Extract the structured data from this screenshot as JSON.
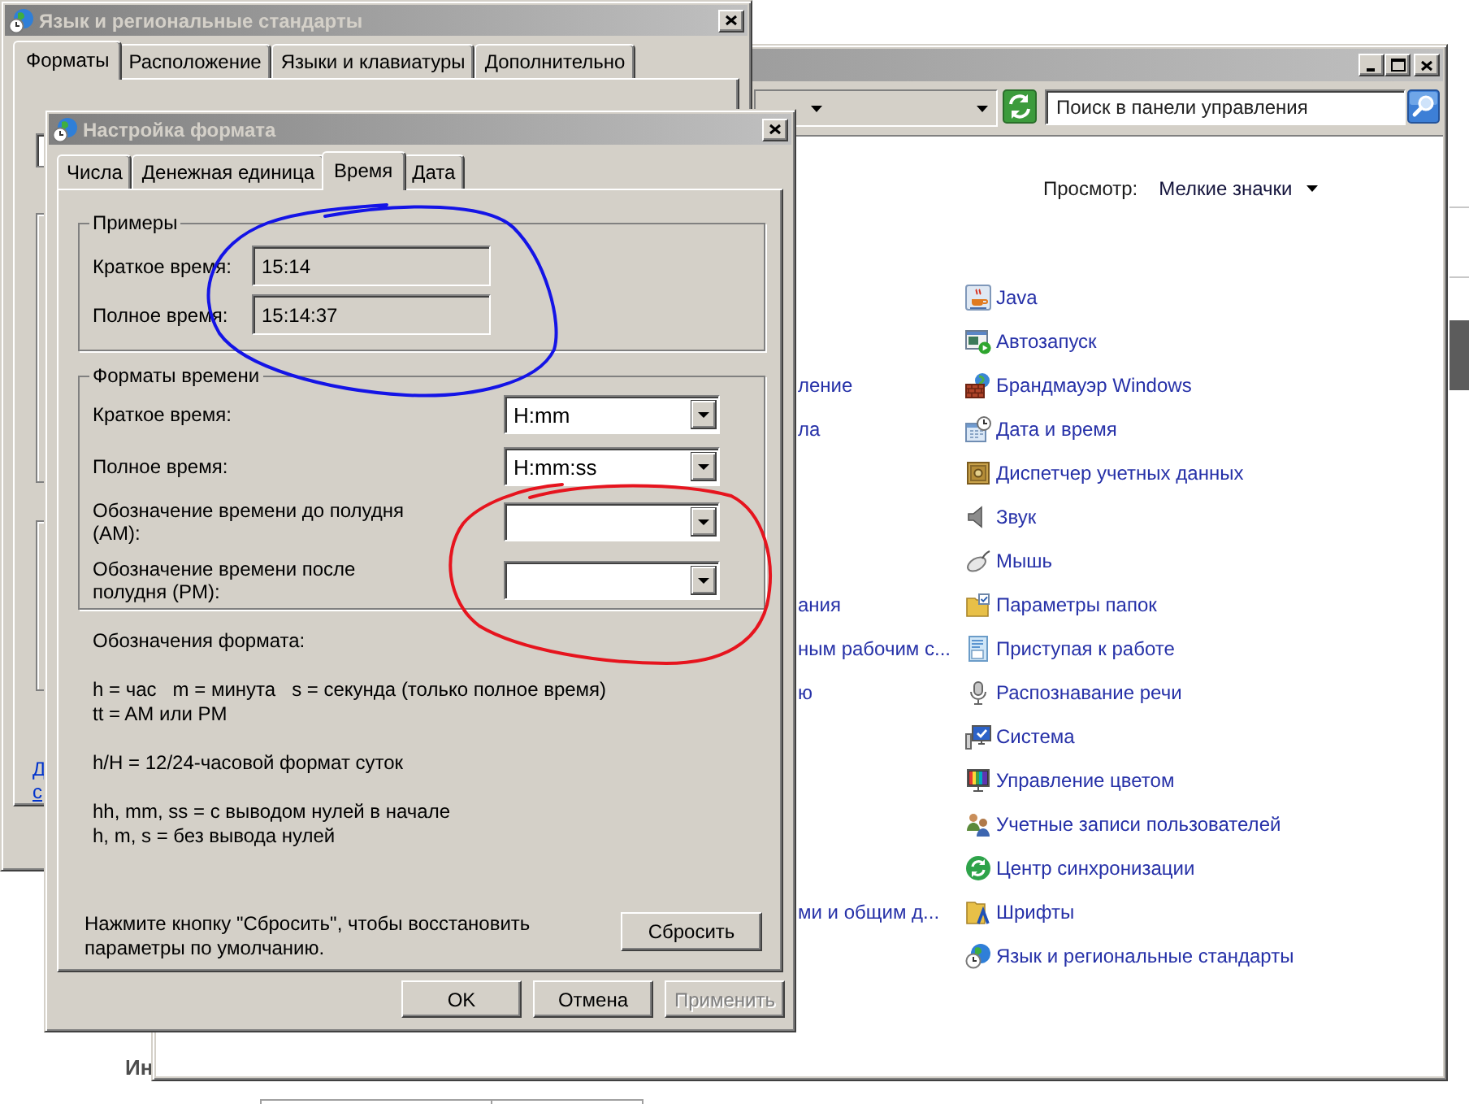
{
  "desktop": {
    "partial_heading": "Ин"
  },
  "control_panel": {
    "active": false,
    "search": {
      "placeholder": "Поиск в панели управления"
    },
    "view_label": "Просмотр:",
    "view_mode": "Мелкие значки",
    "left_column": [
      "ление",
      "ла",
      "ания",
      "ным рабочим с...",
      "ю",
      "ми и общим д..."
    ],
    "items": [
      {
        "kind": "java",
        "label": "Java"
      },
      {
        "kind": "autoplay",
        "label": "Автозапуск"
      },
      {
        "kind": "firewall",
        "label": "Брандмауэр Windows"
      },
      {
        "kind": "datetime",
        "label": "Дата и время"
      },
      {
        "kind": "credentials",
        "label": "Диспетчер учетных данных"
      },
      {
        "kind": "sound",
        "label": "Звук"
      },
      {
        "kind": "mouse",
        "label": "Мышь"
      },
      {
        "kind": "folders",
        "label": "Параметры папок"
      },
      {
        "kind": "start",
        "label": "Приступая к работе"
      },
      {
        "kind": "speech",
        "label": "Распознавание речи"
      },
      {
        "kind": "system",
        "label": "Система"
      },
      {
        "kind": "color",
        "label": "Управление цветом"
      },
      {
        "kind": "users",
        "label": "Учетные записи пользователей"
      },
      {
        "kind": "sync",
        "label": "Центр синхронизации"
      },
      {
        "kind": "fonts",
        "label": "Шрифты"
      },
      {
        "kind": "region",
        "label": "Язык и региональные стандарты"
      }
    ]
  },
  "region_dialog": {
    "title": "Язык и региональные стандарты",
    "active": false,
    "tabs": [
      {
        "label": "Форматы",
        "selected": true
      },
      {
        "label": "Расположение",
        "selected": false
      },
      {
        "label": "Языки и клавиатуры",
        "selected": false
      },
      {
        "label": "Дополнительно",
        "selected": false
      }
    ],
    "link_fragments": [
      "Д",
      "с"
    ]
  },
  "format_dialog": {
    "title": "Настройка формата",
    "active": false,
    "tabs": [
      {
        "label": "Числа",
        "selected": false
      },
      {
        "label": "Денежная единица",
        "selected": false
      },
      {
        "label": "Время",
        "selected": true
      },
      {
        "label": "Дата",
        "selected": false
      }
    ],
    "examples": {
      "legend": "Примеры",
      "rows": [
        {
          "label": "Краткое время:",
          "value": "15:14"
        },
        {
          "label": "Полное время:",
          "value": "15:14:37"
        }
      ]
    },
    "formats": {
      "legend": "Форматы времени",
      "rows": [
        {
          "label": "Краткое время:",
          "value": "H:mm"
        },
        {
          "label": "Полное время:",
          "value": "H:mm:ss"
        },
        {
          "label": "Обозначение времени до полудня (AM):"
        },
        {
          "label": "Обозначение времени после полудня (PM):"
        }
      ]
    },
    "notation_title": "Обозначения формата:",
    "notation_groups": [
      [
        "h = час   m = минута   s = секунда (только полное время)",
        "tt = AM или PM"
      ],
      [
        "h/H = 12/24-часовой формат суток"
      ],
      [
        "hh, mm, ss = с выводом нулей в начале",
        "h, m, s = без вывода нулей"
      ]
    ],
    "reset_hint": "Нажмите кнопку \"Сбросить\", чтобы восстановить параметры по умолчанию.",
    "reset_button": "Сбросить",
    "buttons": [
      {
        "label": "OK",
        "disabled": false
      },
      {
        "label": "Отмена",
        "disabled": false
      },
      {
        "label": "Применить",
        "disabled": true
      }
    ]
  },
  "annotations": [
    {
      "color": "#1414e6"
    },
    {
      "color": "#e6141e"
    }
  ]
}
